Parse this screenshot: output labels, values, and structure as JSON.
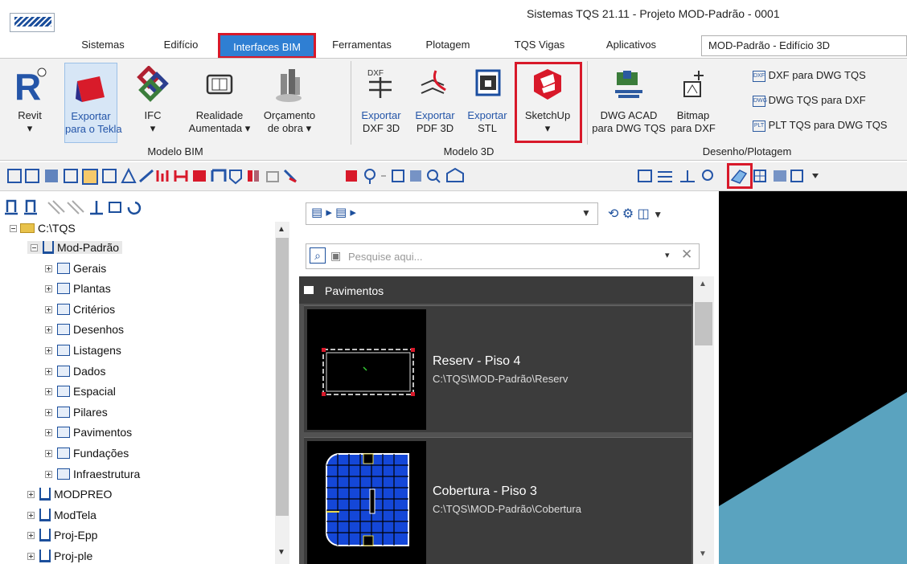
{
  "window": {
    "title": "Sistemas TQS 21.11 - Projeto MOD-Padrão - 0001",
    "document_selector": "MOD-Padrão - Edifício 3D"
  },
  "menu_tabs": [
    "Sistemas",
    "Edifício",
    "Interfaces BIM",
    "Ferramentas",
    "Plotagem",
    "TQS Vigas",
    "Aplicativos"
  ],
  "active_tab": "Interfaces BIM",
  "ribbon": {
    "groups": [
      "Modelo BIM",
      "Modelo 3D",
      "Desenho/Plotagem"
    ],
    "buttons": {
      "revit": [
        "Revit",
        "▾"
      ],
      "tekla": [
        "Exportar",
        "para o Tekla"
      ],
      "ifc": [
        "IFC",
        "▾"
      ],
      "ar": [
        "Realidade",
        "Aumentada ▾"
      ],
      "budget": [
        "Orçamento",
        "de obra ▾"
      ],
      "dxf3d": [
        "Exportar",
        "DXF 3D"
      ],
      "pdf3d": [
        "Exportar",
        "PDF 3D"
      ],
      "stl": [
        "Exportar",
        "STL"
      ],
      "sketchup": [
        "SketchUp",
        "▾"
      ],
      "dwg_acad": [
        "DWG ACAD",
        "para DWG TQS"
      ],
      "bitmap": [
        "Bitmap",
        "para DXF"
      ]
    },
    "small_links": [
      "DXF para DWG TQS",
      "DWG TQS para DXF",
      "PLT TQS para DWG TQS"
    ]
  },
  "tree": {
    "root": "C:\\TQS",
    "items": [
      {
        "label": "Mod-Padrão",
        "level": 1,
        "selected": true
      },
      {
        "label": "Gerais",
        "level": 2
      },
      {
        "label": "Plantas",
        "level": 2
      },
      {
        "label": "Critérios",
        "level": 2
      },
      {
        "label": "Desenhos",
        "level": 2
      },
      {
        "label": "Listagens",
        "level": 2
      },
      {
        "label": "Dados",
        "level": 2
      },
      {
        "label": "Espacial",
        "level": 2
      },
      {
        "label": "Pilares",
        "level": 2
      },
      {
        "label": "Pavimentos",
        "level": 2
      },
      {
        "label": "Fundações",
        "level": 2
      },
      {
        "label": "Infraestrutura",
        "level": 2
      },
      {
        "label": "MODPREO",
        "level": 1
      },
      {
        "label": "ModTela",
        "level": 1
      },
      {
        "label": "Proj-Epp",
        "level": 1
      },
      {
        "label": "Proj-ple",
        "level": 1
      }
    ]
  },
  "browser": {
    "search_placeholder": "Pesquise aqui...",
    "section_title": "Pavimentos",
    "cards": [
      {
        "title": "Reserv - Piso 4",
        "path": "C:\\TQS\\MOD-Padrão\\Reserv"
      },
      {
        "title": "Cobertura - Piso 3",
        "path": "C:\\TQS\\MOD-Padrão\\Cobertura"
      }
    ]
  },
  "colors": {
    "highlight": "#d8192a",
    "accent": "#2f7fd3",
    "model_surface": "#5aa3bf"
  }
}
